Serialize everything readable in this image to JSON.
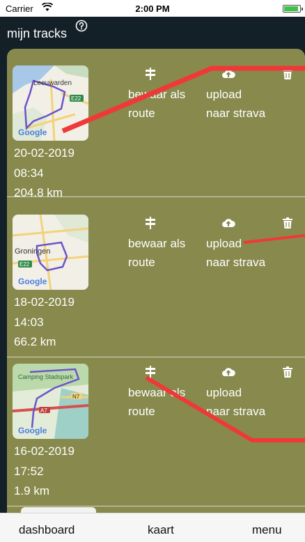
{
  "status_bar": {
    "carrier": "Carrier",
    "time": "2:00 PM"
  },
  "header": {
    "title": "mijn tracks"
  },
  "tracks": [
    {
      "date": "20-02-2019",
      "time": "08:34",
      "distance": "204.8 km",
      "map_city": "Leeuwarden",
      "map_badge": "E22",
      "map_brand": "Google",
      "route_label_line1": "bewaar als",
      "route_label_line2": "route",
      "upload_label_line1": "upload",
      "upload_label_line2": "naar strava"
    },
    {
      "date": "18-02-2019",
      "time": "14:03",
      "distance": "66.2 km",
      "map_city": "Groningen",
      "map_badge": "E22",
      "map_brand": "Google",
      "route_label_line1": "bewaar als",
      "route_label_line2": "route",
      "upload_label_line1": "upload",
      "upload_label_line2": "naar strava"
    },
    {
      "date": "16-02-2019",
      "time": "17:52",
      "distance": "1.9 km",
      "map_city": "Camping Stadspark",
      "map_badge": "A7",
      "map_badge2": "N7",
      "map_brand": "Google",
      "route_label_line1": "bewaar als",
      "route_label_line2": "route",
      "upload_label_line1": "upload",
      "upload_label_line2": "naar strava"
    }
  ],
  "tabbar": {
    "dashboard": "dashboard",
    "kaart": "kaart",
    "menu": "menu"
  },
  "colors": {
    "header_bg": "#142028",
    "card_bg": "#878a4c",
    "annotation_line": "#f03838"
  },
  "icons": {
    "route": "signpost-icon",
    "upload": "cloud-upload-icon",
    "delete": "trash-icon",
    "help": "question-circle-icon"
  }
}
